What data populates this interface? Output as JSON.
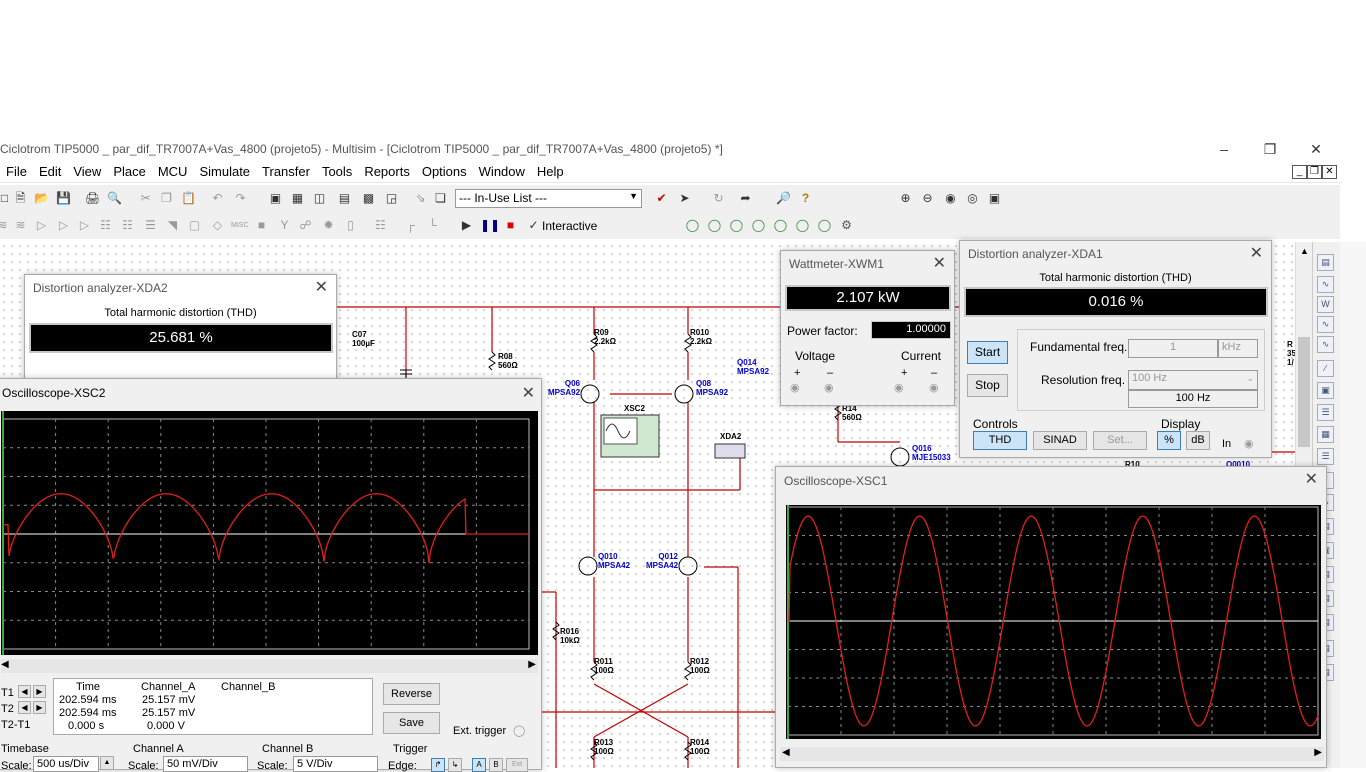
{
  "window": {
    "title": "Ciclotrom TIP5000 _ par_dif_TR7007A+Vas_4800 (projeto5) - Multisim - [Ciclotrom TIP5000 _ par_dif_TR7007A+Vas_4800 (projeto5) *]",
    "minimize": "–",
    "restore": "❐",
    "close": "✕"
  },
  "menu": [
    "File",
    "Edit",
    "View",
    "Place",
    "MCU",
    "Simulate",
    "Transfer",
    "Tools",
    "Reports",
    "Options",
    "Window",
    "Help"
  ],
  "toolbar": {
    "inuse": "--- In-Use List ---",
    "interactive": "Interactive"
  },
  "xda2": {
    "title": "Distortion analyzer-XDA2",
    "heading": "Total harmonic distortion (THD)",
    "value": "25.681 %"
  },
  "xwm1": {
    "title": "Wattmeter-XWM1",
    "value": "2.107 kW",
    "pf_label": "Power factor:",
    "pf_value": "1.00000",
    "voltage": "Voltage",
    "current": "Current",
    "plus": "+",
    "minus": "–"
  },
  "xda1": {
    "title": "Distortion analyzer-XDA1",
    "heading": "Total harmonic distortion (THD)",
    "value": "0.016 %",
    "start": "Start",
    "stop": "Stop",
    "fund_label": "Fundamental freq.",
    "fund_value": "1",
    "fund_unit": "kHz",
    "res_label": "Resolution freq.",
    "res_value": "100 Hz",
    "res_display": "100 Hz",
    "controls": "Controls",
    "thd": "THD",
    "sinad": "SINAD",
    "set": "Set...",
    "display": "Display",
    "pct": "%",
    "db": "dB",
    "in": "In"
  },
  "xsc2": {
    "title": "Oscilloscope-XSC2",
    "table": {
      "headers": [
        "Time",
        "Channel_A",
        "Channel_B"
      ],
      "rows": [
        [
          "T1",
          "202.594 ms",
          "25.157 mV",
          ""
        ],
        [
          "T2",
          "202.594 ms",
          "25.157 mV",
          ""
        ],
        [
          "T2-T1",
          "0.000 s",
          "0.000 V",
          ""
        ]
      ]
    },
    "reverse": "Reverse",
    "save": "Save",
    "ext": "Ext. trigger",
    "timebase": "Timebase",
    "chA": "Channel A",
    "chB": "Channel B",
    "trigger": "Trigger",
    "scale": "Scale:",
    "tb_value": "500 us/Div",
    "chA_value": "50 mV/Div",
    "chB_value": "5  V/Div",
    "edge": "Edge:",
    "line_color": "#e0201a"
  },
  "xsc1": {
    "title": "Oscilloscope-XSC1",
    "line_color": "#e0201a"
  },
  "components": {
    "c07": [
      "C07",
      "100µF"
    ],
    "r08": [
      "R08",
      "560Ω"
    ],
    "r09": [
      "R09",
      "2.2kΩ"
    ],
    "r010": [
      "R010",
      "2.2kΩ"
    ],
    "q06": [
      "Q06",
      "MPSA92"
    ],
    "q08": [
      "Q08",
      "MPSA92"
    ],
    "q014": [
      "Q014",
      "MPSA92"
    ],
    "xsc2": "XSC2",
    "xda2": "XDA2",
    "r14": [
      "R14",
      "560Ω"
    ],
    "q016": [
      "Q016",
      "MJE15033"
    ],
    "q010": [
      "Q010",
      "MPSA42"
    ],
    "q012": [
      "Q012",
      "MPSA42"
    ],
    "r016": [
      "R016",
      "10kΩ"
    ],
    "r011": [
      "R011",
      "100Ω"
    ],
    "r012": [
      "R012",
      "100Ω"
    ],
    "r013": [
      "R013",
      "100Ω"
    ],
    "r014": [
      "R014",
      "100Ω"
    ],
    "r10": "R10",
    "q0010": "Q0010",
    "r_edge": [
      "R",
      "35",
      "1/"
    ]
  }
}
